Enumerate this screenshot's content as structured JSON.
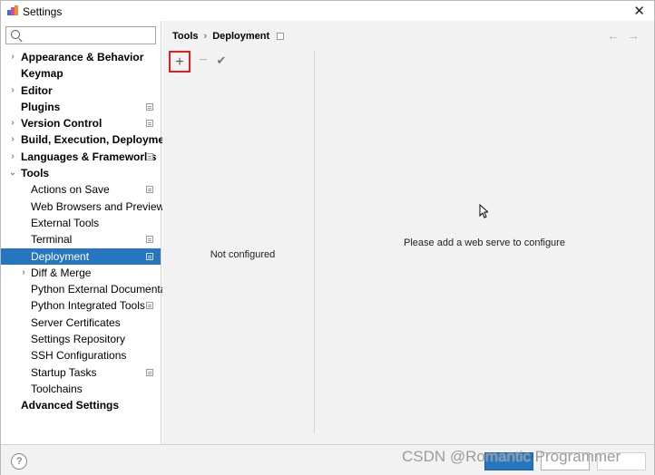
{
  "window": {
    "title": "Settings"
  },
  "search": {
    "value": "",
    "placeholder": ""
  },
  "sidebar": {
    "items": [
      {
        "label": "Appearance & Behavior",
        "level": "top",
        "chevron": "›",
        "project": false
      },
      {
        "label": "Keymap",
        "level": "top",
        "chevron": "",
        "project": false
      },
      {
        "label": "Editor",
        "level": "top",
        "chevron": "›",
        "project": false
      },
      {
        "label": "Plugins",
        "level": "top",
        "chevron": "",
        "project": true
      },
      {
        "label": "Version Control",
        "level": "top",
        "chevron": "›",
        "project": true
      },
      {
        "label": "Build, Execution, Deployment",
        "level": "top",
        "chevron": "›",
        "project": false
      },
      {
        "label": "Languages & Frameworks",
        "level": "top",
        "chevron": "›",
        "project": true
      },
      {
        "label": "Tools",
        "level": "top",
        "chevron": "⌄",
        "project": false
      },
      {
        "label": "Actions on Save",
        "level": "sub",
        "chevron": "",
        "project": true
      },
      {
        "label": "Web Browsers and Preview",
        "level": "sub",
        "chevron": "",
        "project": false
      },
      {
        "label": "External Tools",
        "level": "sub",
        "chevron": "",
        "project": false
      },
      {
        "label": "Terminal",
        "level": "sub",
        "chevron": "",
        "project": true
      },
      {
        "label": "Deployment",
        "level": "sub",
        "chevron": "",
        "project": true,
        "selected": true
      },
      {
        "label": "Diff & Merge",
        "level": "sub",
        "chevron": "›",
        "project": false
      },
      {
        "label": "Python External Documentation",
        "level": "sub",
        "chevron": "",
        "project": false
      },
      {
        "label": "Python Integrated Tools",
        "level": "sub",
        "chevron": "",
        "project": true
      },
      {
        "label": "Server Certificates",
        "level": "sub",
        "chevron": "",
        "project": false
      },
      {
        "label": "Settings Repository",
        "level": "sub",
        "chevron": "",
        "project": false
      },
      {
        "label": "SSH Configurations",
        "level": "sub",
        "chevron": "",
        "project": false
      },
      {
        "label": "Startup Tasks",
        "level": "sub",
        "chevron": "",
        "project": true
      },
      {
        "label": "Toolchains",
        "level": "sub",
        "chevron": "",
        "project": false
      },
      {
        "label": "Advanced Settings",
        "level": "top",
        "chevron": "",
        "project": false
      }
    ]
  },
  "breadcrumb": {
    "parent": "Tools",
    "separator": "›",
    "current": "Deployment"
  },
  "nav": {
    "back": "←",
    "forward": "→"
  },
  "toolbar": {
    "add": "+",
    "remove": "−",
    "apply": "✔"
  },
  "list": {
    "empty_text": "Not configured"
  },
  "detail": {
    "empty_text": "Please add a web serve to configure"
  },
  "footer": {
    "help": "?"
  },
  "watermark": {
    "text": "CSDN @Romantic Programmer"
  },
  "colors": {
    "selection": "#2675bf",
    "highlight": "#e02020"
  }
}
